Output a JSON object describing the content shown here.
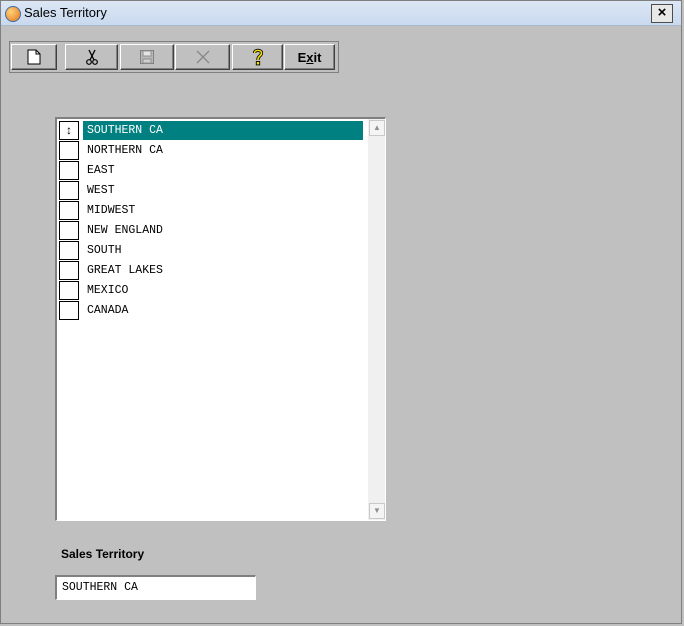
{
  "window": {
    "title": "Sales Territory",
    "close_label": "×"
  },
  "toolbar": {
    "buttons": [
      {
        "icon": "new-document-icon",
        "enabled": true
      },
      {
        "icon": "cut-scissors-icon",
        "enabled": true
      },
      {
        "icon": "save-disk-icon",
        "enabled": false
      },
      {
        "icon": "delete-x-icon",
        "enabled": false
      },
      {
        "icon": "help-question-icon",
        "enabled": true
      },
      {
        "label": "Exit",
        "mnemonic": "x",
        "enabled": true
      }
    ]
  },
  "list": {
    "selected_marker": "↕",
    "items": [
      {
        "label": "SOUTHERN CA",
        "selected": true
      },
      {
        "label": "NORTHERN CA",
        "selected": false
      },
      {
        "label": "EAST",
        "selected": false
      },
      {
        "label": "WEST",
        "selected": false
      },
      {
        "label": "MIDWEST",
        "selected": false
      },
      {
        "label": "NEW ENGLAND",
        "selected": false
      },
      {
        "label": "SOUTH",
        "selected": false
      },
      {
        "label": "GREAT LAKES",
        "selected": false
      },
      {
        "label": "MEXICO",
        "selected": false
      },
      {
        "label": "CANADA",
        "selected": false
      }
    ]
  },
  "form": {
    "field_label": "Sales Territory",
    "field_value": "SOUTHERN CA"
  },
  "colors": {
    "selection": "#008080",
    "background": "#c0c0c0"
  }
}
